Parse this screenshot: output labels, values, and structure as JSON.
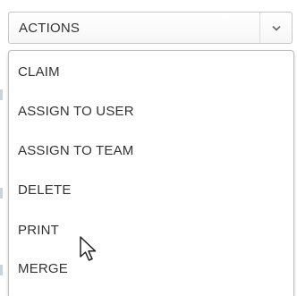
{
  "dropdown": {
    "label": "ACTIONS",
    "arrow_icon": "chevron-down-icon"
  },
  "menu": {
    "items": [
      {
        "label": "CLAIM"
      },
      {
        "label": "ASSIGN TO USER"
      },
      {
        "label": "ASSIGN TO TEAM"
      },
      {
        "label": "DELETE"
      },
      {
        "label": "PRINT"
      },
      {
        "label": "MERGE"
      }
    ],
    "hovered_item": "PRINT"
  },
  "cursor": {
    "icon": "mouse-pointer-icon"
  },
  "colors": {
    "text": "#333333",
    "border": "#c7c7c7",
    "background": "#ffffff"
  }
}
